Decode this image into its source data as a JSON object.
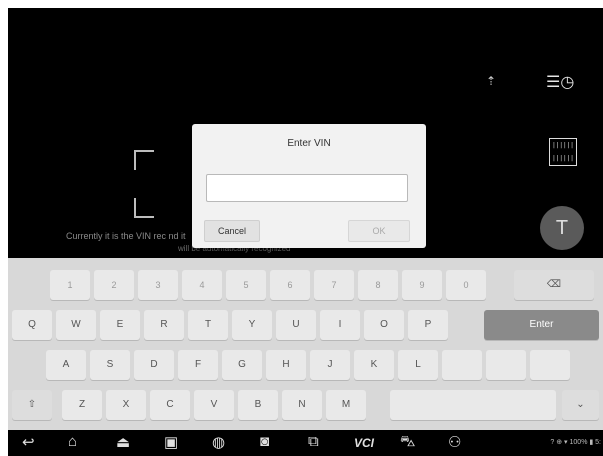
{
  "scanner": {
    "hint_line1": "Currently it is the VIN rec                                                              nd it",
    "hint_line2": "will be automatically recognized",
    "torch_icon": "flashlight-icon",
    "history_icon": "history-icon",
    "barcode_label": "|||||| ||||||",
    "text_scan_label": "T"
  },
  "dialog": {
    "title": "Enter VIN",
    "input_value": "",
    "input_placeholder": "",
    "cancel_label": "Cancel",
    "ok_label": "OK"
  },
  "keyboard": {
    "row1": [
      "1",
      "2",
      "3",
      "4",
      "5",
      "6",
      "7",
      "8",
      "9",
      "0"
    ],
    "row2": [
      "Q",
      "W",
      "E",
      "R",
      "T",
      "Y",
      "U",
      "I",
      "O",
      "P"
    ],
    "row3": [
      "A",
      "S",
      "D",
      "F",
      "G",
      "H",
      "J",
      "K",
      "L"
    ],
    "row4": [
      "Z",
      "X",
      "C",
      "V",
      "B",
      "N",
      "M"
    ],
    "backspace_label": "⌫",
    "enter_label": "Enter",
    "shift_label": "⇧",
    "hide_label": "⌄"
  },
  "navbar": {
    "icons": [
      "back-icon",
      "home-icon",
      "vci-home-icon",
      "recent-apps-icon",
      "browser-icon",
      "camera-icon",
      "screenshot-icon",
      "vci-icon",
      "vehicle-icon",
      "user-icon"
    ],
    "status_text": "? ⊕ ▾ 100% ▮ 5:"
  }
}
